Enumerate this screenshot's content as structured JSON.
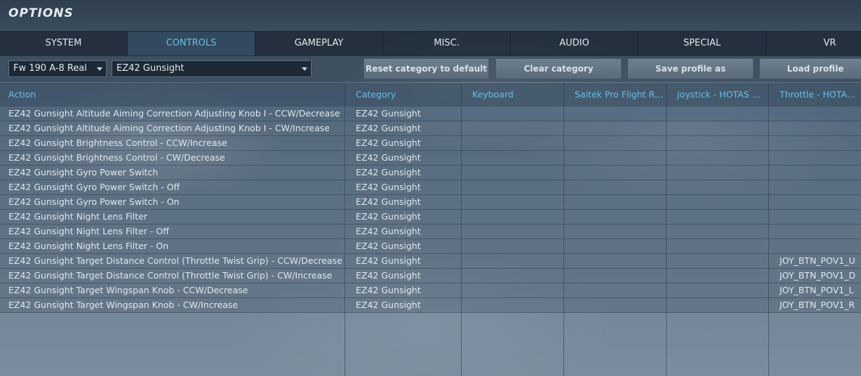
{
  "window": {
    "title": "OPTIONS"
  },
  "tabs": [
    {
      "label": "SYSTEM"
    },
    {
      "label": "CONTROLS"
    },
    {
      "label": "GAMEPLAY"
    },
    {
      "label": "MISC."
    },
    {
      "label": "AUDIO"
    },
    {
      "label": "SPECIAL"
    },
    {
      "label": "VR"
    }
  ],
  "active_tab": "CONTROLS",
  "toolbar": {
    "aircraft_select": "Fw 190 A-8 Real",
    "category_select": "EZ42 Gunsight",
    "reset_label": "Reset category to default",
    "clear_label": "Clear category",
    "save_label": "Save profile as",
    "load_label": "Load profile"
  },
  "table": {
    "columns": [
      "Action",
      "Category",
      "Keyboard",
      "Saitek Pro Flight Ru...",
      "Joystick - HOTAS Wa...",
      "Throttle - HOTAS W..."
    ],
    "rows": [
      [
        "EZ42 Gunsight Altitude Aiming Correction Adjusting Knob I - CCW/Decrease",
        "EZ42 Gunsight",
        "",
        "",
        "",
        ""
      ],
      [
        "EZ42 Gunsight Altitude Aiming Correction Adjusting Knob I - CW/Increase",
        "EZ42 Gunsight",
        "",
        "",
        "",
        ""
      ],
      [
        "EZ42 Gunsight Brightness Control - CCW/Increase",
        "EZ42 Gunsight",
        "",
        "",
        "",
        ""
      ],
      [
        "EZ42 Gunsight Brightness Control - CW/Decrease",
        "EZ42 Gunsight",
        "",
        "",
        "",
        ""
      ],
      [
        "EZ42 Gunsight Gyro Power Switch",
        "EZ42 Gunsight",
        "",
        "",
        "",
        ""
      ],
      [
        "EZ42 Gunsight Gyro Power Switch - Off",
        "EZ42 Gunsight",
        "",
        "",
        "",
        ""
      ],
      [
        "EZ42 Gunsight Gyro Power Switch - On",
        "EZ42 Gunsight",
        "",
        "",
        "",
        ""
      ],
      [
        "EZ42 Gunsight Night Lens Filter",
        "EZ42 Gunsight",
        "",
        "",
        "",
        ""
      ],
      [
        "EZ42 Gunsight Night Lens Filter - Off",
        "EZ42 Gunsight",
        "",
        "",
        "",
        ""
      ],
      [
        "EZ42 Gunsight Night Lens Filter - On",
        "EZ42 Gunsight",
        "",
        "",
        "",
        ""
      ],
      [
        "EZ42 Gunsight Target Distance Control (Throttle Twist Grip) - CCW/Decrease",
        "EZ42 Gunsight",
        "",
        "",
        "",
        "JOY_BTN_POV1_U"
      ],
      [
        "EZ42 Gunsight Target Distance Control (Throttle Twist Grip) - CW/Increase",
        "EZ42 Gunsight",
        "",
        "",
        "",
        "JOY_BTN_POV1_D"
      ],
      [
        "EZ42 Gunsight Target Wingspan Knob - CCW/Decrease",
        "EZ42 Gunsight",
        "",
        "",
        "",
        "JOY_BTN_POV1_L"
      ],
      [
        "EZ42 Gunsight Target Wingspan Knob - CW/Increase",
        "EZ42 Gunsight",
        "",
        "",
        "",
        "JOY_BTN_POV1_R"
      ]
    ]
  }
}
